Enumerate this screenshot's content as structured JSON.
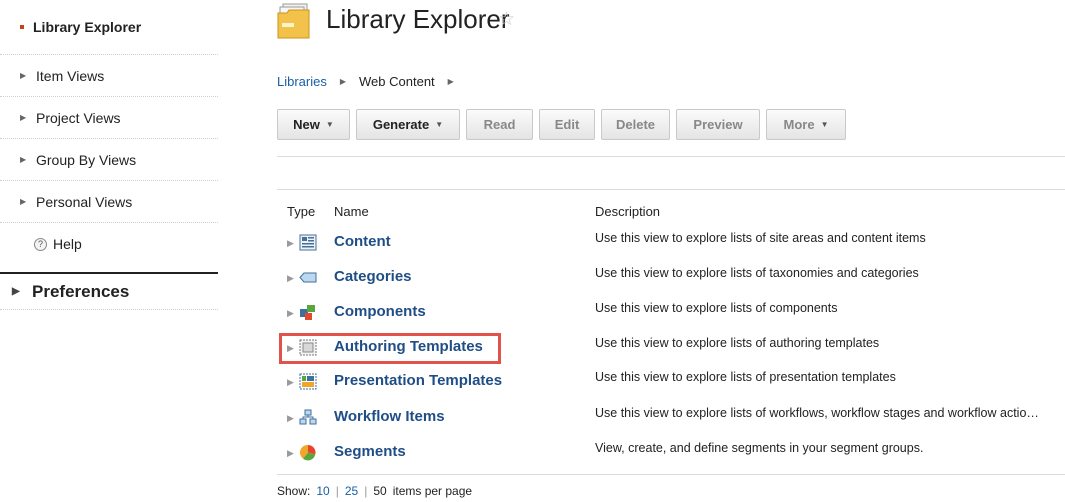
{
  "sidebar": {
    "items": [
      {
        "label": "Library Explorer"
      },
      {
        "label": "Item Views"
      },
      {
        "label": "Project Views"
      },
      {
        "label": "Group By Views"
      },
      {
        "label": "Personal Views"
      },
      {
        "label": "Help"
      }
    ],
    "preferences": "Preferences"
  },
  "header": {
    "title": "Library Explorer"
  },
  "breadcrumb": {
    "items": [
      "Libraries",
      "Web Content"
    ]
  },
  "toolbar": {
    "new": "New",
    "generate": "Generate",
    "read": "Read",
    "edit": "Edit",
    "delete": "Delete",
    "preview": "Preview",
    "more": "More"
  },
  "table": {
    "headers": {
      "type": "Type",
      "name": "Name",
      "description": "Description"
    },
    "rows": [
      {
        "name": "Content",
        "description": "Use this view to explore lists of site areas and content items",
        "icon": "content-icon"
      },
      {
        "name": "Categories",
        "description": "Use this view to explore lists of taxonomies and categories",
        "icon": "category-icon"
      },
      {
        "name": "Components",
        "description": "Use this view to explore lists of components",
        "icon": "component-icon"
      },
      {
        "name": "Authoring Templates",
        "description": "Use this view to explore lists of authoring templates",
        "icon": "authoring-template-icon"
      },
      {
        "name": "Presentation Templates",
        "description": "Use this view to explore lists of presentation templates",
        "icon": "presentation-template-icon"
      },
      {
        "name": "Workflow Items",
        "description": "Use this view to explore lists of workflows, workflow stages and workflow actio…",
        "icon": "workflow-icon"
      },
      {
        "name": "Segments",
        "description": "View, create, and define segments in your segment groups.",
        "icon": "segments-icon"
      }
    ]
  },
  "pager": {
    "show": "Show:",
    "options": [
      "10",
      "25",
      "50"
    ],
    "suffix": "items per page"
  },
  "colors": {
    "link": "#1a5ea6",
    "row_name": "#1f4e86",
    "highlight": "#e0524a",
    "active_bullet": "#c5421b"
  }
}
